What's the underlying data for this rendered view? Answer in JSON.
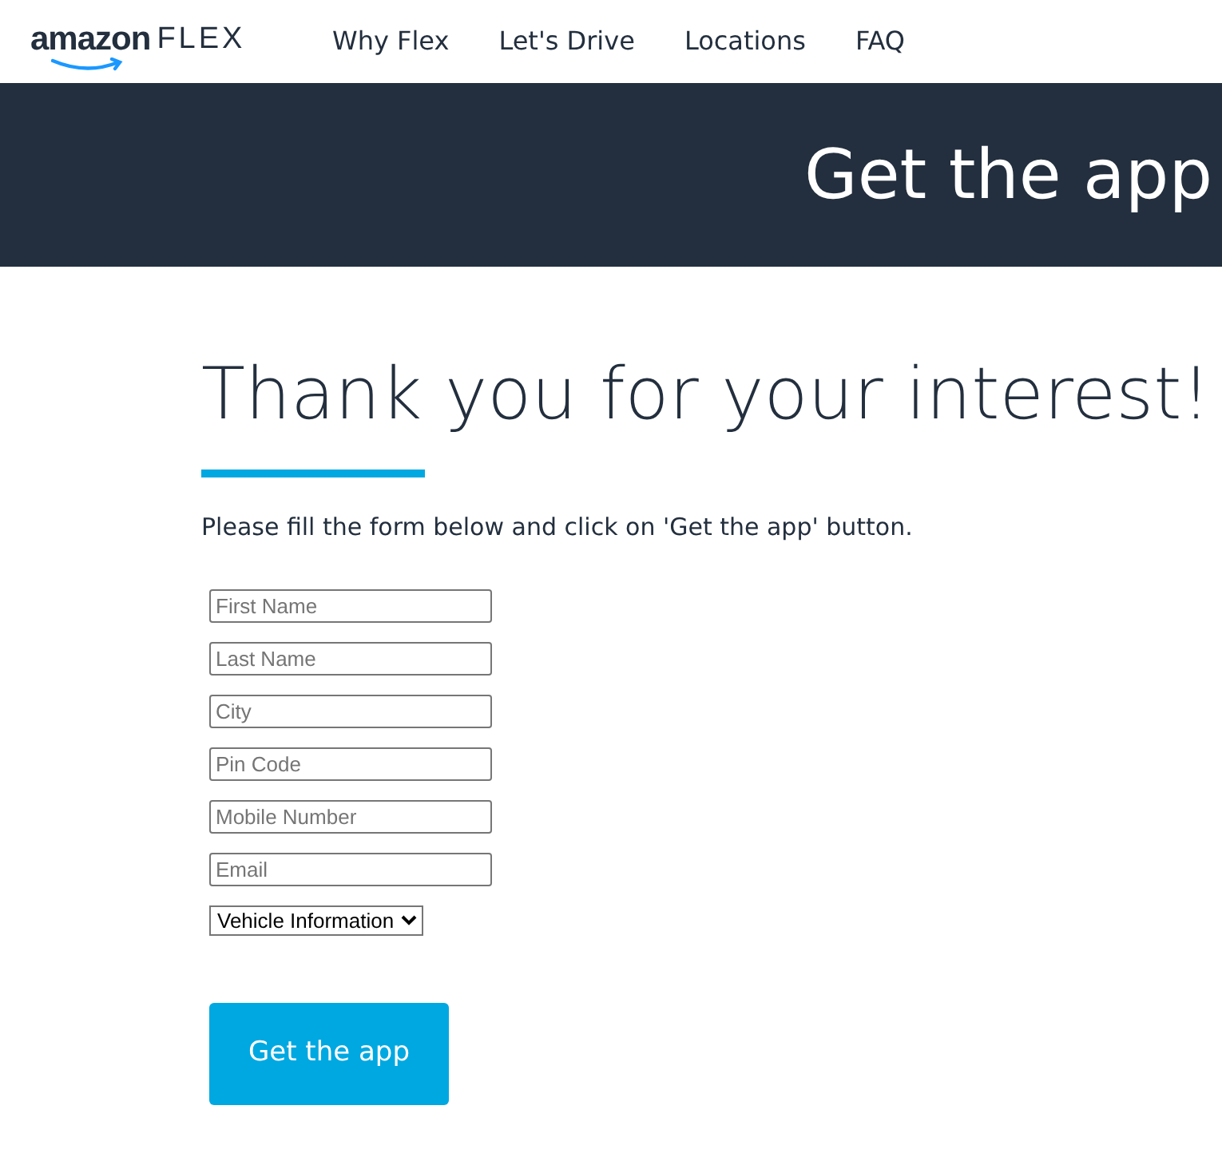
{
  "logo": {
    "brand": "amazon",
    "product": "FLEX"
  },
  "nav": [
    {
      "label": "Why Flex"
    },
    {
      "label": "Let's Drive"
    },
    {
      "label": "Locations"
    },
    {
      "label": "FAQ"
    }
  ],
  "banner": {
    "title": "Get the app"
  },
  "heading": "Thank you for your interest!",
  "instructions": "Please fill the form below and click on 'Get the app' button.",
  "fields": [
    {
      "placeholder": "First Name"
    },
    {
      "placeholder": "Last Name"
    },
    {
      "placeholder": "City"
    },
    {
      "placeholder": "Pin Code"
    },
    {
      "placeholder": "Mobile Number"
    },
    {
      "placeholder": "Email"
    }
  ],
  "vehicle_select": {
    "value": "Vehicle Information"
  },
  "submit_button": "Get the app"
}
